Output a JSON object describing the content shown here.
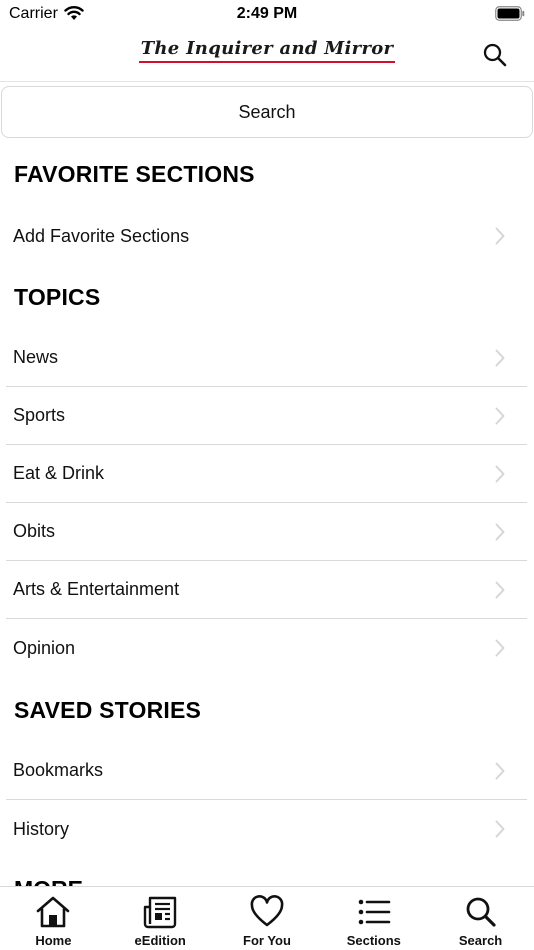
{
  "status_bar": {
    "carrier": "Carrier",
    "time": "2:49 PM"
  },
  "header": {
    "logo_text": "The Inquirer and Mirror"
  },
  "search": {
    "label": "Search"
  },
  "favorites": {
    "heading": "FAVORITE SECTIONS",
    "add_label": "Add Favorite Sections"
  },
  "topics": {
    "heading": "TOPICS",
    "items": [
      {
        "label": "News"
      },
      {
        "label": "Sports"
      },
      {
        "label": "Eat & Drink"
      },
      {
        "label": "Obits"
      },
      {
        "label": "Arts & Entertainment"
      },
      {
        "label": "Opinion"
      }
    ]
  },
  "saved": {
    "heading": "SAVED STORIES",
    "items": [
      {
        "label": "Bookmarks"
      },
      {
        "label": "History"
      }
    ]
  },
  "more": {
    "heading": "MORE"
  },
  "tab_bar": {
    "tabs": [
      {
        "label": "Home",
        "icon": "home-icon"
      },
      {
        "label": "eEdition",
        "icon": "newspaper-icon"
      },
      {
        "label": "For You",
        "icon": "heart-icon"
      },
      {
        "label": "Sections",
        "icon": "list-icon"
      },
      {
        "label": "Search",
        "icon": "search-icon"
      }
    ]
  }
}
